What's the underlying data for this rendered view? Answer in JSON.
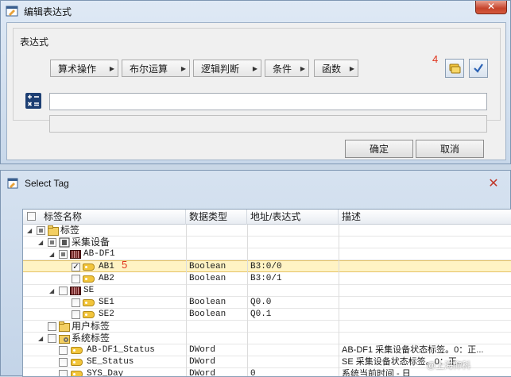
{
  "dialog1": {
    "title": "编辑表达式",
    "close_glyph": "✕",
    "group_label": "表达式",
    "menus": [
      {
        "label": "算术操作"
      },
      {
        "label": "布尔运算"
      },
      {
        "label": "逻辑判断"
      },
      {
        "label": "条件"
      },
      {
        "label": "函数"
      }
    ],
    "annotation": "4",
    "expression_value": "",
    "ok_label": "确定",
    "cancel_label": "取消",
    "icons": {
      "app": "window-icon",
      "select_tag": "tag-select-icon",
      "check": "check-icon",
      "calculator": "calculator-icon"
    }
  },
  "dialog2": {
    "title": "Select Tag",
    "close_glyph": "✕",
    "columns": [
      "标签名称",
      "数据类型",
      "地址/表达式",
      "描述"
    ],
    "annotation": "5",
    "rows": [
      {
        "name": "标签",
        "type": "",
        "address": "",
        "desc": ""
      },
      {
        "name": "采集设备",
        "type": "",
        "address": "",
        "desc": ""
      },
      {
        "name": "AB-DF1",
        "type": "",
        "address": "",
        "desc": ""
      },
      {
        "name": "AB1",
        "type": "Boolean",
        "address": "B3:0/0",
        "desc": ""
      },
      {
        "name": "AB2",
        "type": "Boolean",
        "address": "B3:0/1",
        "desc": ""
      },
      {
        "name": "SE",
        "type": "",
        "address": "",
        "desc": ""
      },
      {
        "name": "SE1",
        "type": "Boolean",
        "address": "Q0.0",
        "desc": ""
      },
      {
        "name": "SE2",
        "type": "Boolean",
        "address": "Q0.1",
        "desc": ""
      },
      {
        "name": "用户标签",
        "type": "",
        "address": "",
        "desc": ""
      },
      {
        "name": "系统标签",
        "type": "",
        "address": "",
        "desc": ""
      },
      {
        "name": "AB-DF1_Status",
        "type": "DWord",
        "address": "",
        "desc": "AB-DF1 采集设备状态标签。0：正..."
      },
      {
        "name": "SE_Status",
        "type": "DWord",
        "address": "",
        "desc": "SE 采集设备状态标签。0：正..."
      },
      {
        "name": "SYS_Day",
        "type": "DWord",
        "address": "0",
        "desc": "系统当前时间 - 日"
      }
    ],
    "watermark": "@上海仰科",
    "colors": {
      "selected_row": "#fff3c4",
      "annotation": "#e0341c"
    }
  }
}
